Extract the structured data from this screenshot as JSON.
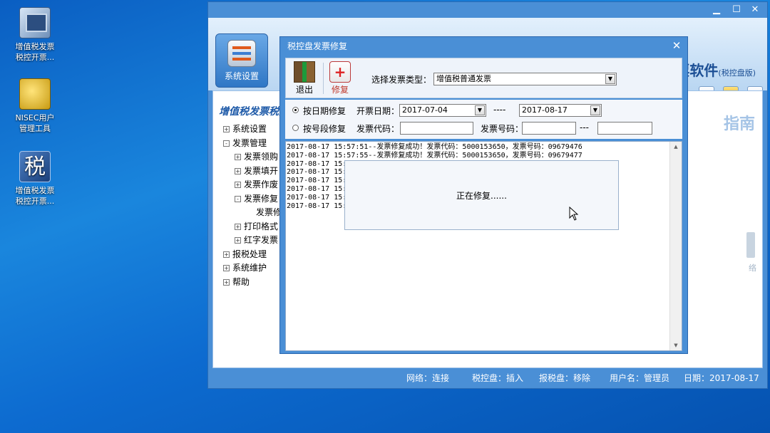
{
  "desktop": {
    "icons": [
      {
        "label": "增值税发票\n税控开票...",
        "icon": "invoice-app-icon"
      },
      {
        "label": "NISEC用户\n管理工具",
        "icon": "key-shield-icon"
      },
      {
        "label": "增值税发票\n税控开票...",
        "icon": "tax-char-icon",
        "glyph": "税"
      }
    ]
  },
  "main_window": {
    "controls": {
      "minimize": "▁",
      "maximize": "☐",
      "close": "✕"
    },
    "system_settings_label": "系统设置",
    "brand_text": "票软件",
    "brand_sub": "(税控盘版)",
    "left_title": "增值税发票税控",
    "guide_text": "指南",
    "ghost_label": "络",
    "tree": [
      {
        "toggle": "+",
        "label": "系统设置",
        "level": 0
      },
      {
        "toggle": "-",
        "label": "发票管理",
        "level": 0
      },
      {
        "toggle": "+",
        "label": "发票领购",
        "level": 1
      },
      {
        "toggle": "+",
        "label": "发票填开",
        "level": 1
      },
      {
        "toggle": "+",
        "label": "发票作废",
        "level": 1
      },
      {
        "toggle": "-",
        "label": "发票修复",
        "level": 1
      },
      {
        "toggle": "",
        "label": "发票修",
        "level": 2
      },
      {
        "toggle": "+",
        "label": "打印格式",
        "level": 1
      },
      {
        "toggle": "+",
        "label": "红字发票",
        "level": 1
      },
      {
        "toggle": "+",
        "label": "报税处理",
        "level": 0
      },
      {
        "toggle": "+",
        "label": "系统维护",
        "level": 0
      },
      {
        "toggle": "+",
        "label": "帮助",
        "level": 0
      }
    ],
    "status": {
      "network": "网络：连接",
      "tax_disk": "税控盘：插入",
      "report_disk": "报税盘：移除",
      "user": "用户名：管理员",
      "date": "日期：2017-08-17"
    }
  },
  "dialog": {
    "title": "税控盘发票修复",
    "close": "✕",
    "toolbar": {
      "exit": "退出",
      "repair": "修复"
    },
    "invoice_type_label": "选择发票类型：",
    "invoice_type_value": "增值税普通发票",
    "mode_by_date": "按日期修复",
    "mode_by_number": "按号段修复",
    "date_label": "开票日期：",
    "date_from": "2017-07-04",
    "date_sep": "----",
    "date_to": "2017-08-17",
    "code_label": "发票代码：",
    "number_label": "发票号码：",
    "number_sep": "---",
    "log_lines": [
      "2017-08-17 15:57:51--发票修复成功！发票代码：5000153650，发票号码：09679476",
      "2017-08-17 15:57:55--发票修复成功！发票代码：5000153650，发票号码：09679477",
      "2017-08-17 15:",
      "2017-08-17 15:",
      "2017-08-17 15:",
      "2017-08-17 15:",
      "2017-08-17 15:",
      "2017-08-17 15:"
    ],
    "progress_text": "正在修复......"
  }
}
